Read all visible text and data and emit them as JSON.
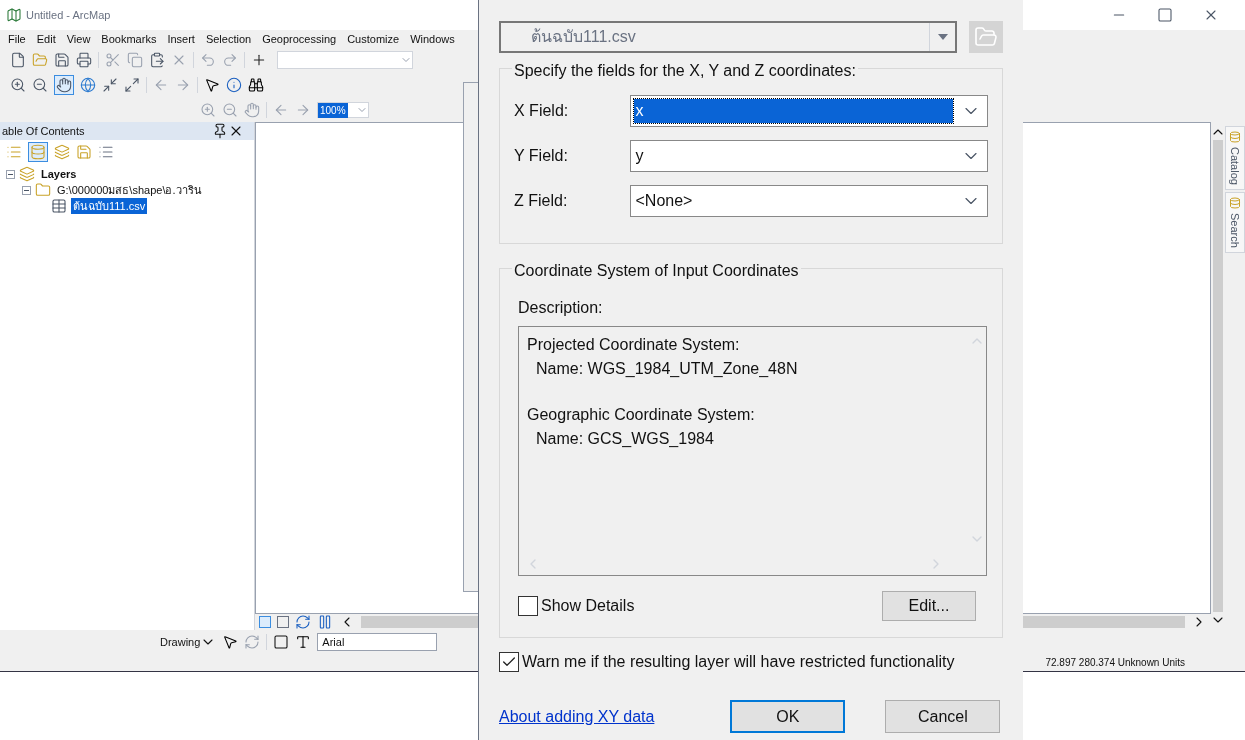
{
  "window": {
    "title": "Untitled - ArcMap"
  },
  "menu": [
    "File",
    "Edit",
    "View",
    "Bookmarks",
    "Insert",
    "Selection",
    "Geoprocessing",
    "Customize",
    "Windows"
  ],
  "zoom_field": {
    "value": "100%"
  },
  "toc": {
    "title": "able Of Contents",
    "tree": [
      {
        "label": "Layers",
        "kind": "group",
        "expanded": true,
        "children": [
          {
            "label": "G:\\000000มสธ\\shape\\อ.วาริน",
            "kind": "folder",
            "expanded": true,
            "children": [
              {
                "label": "ต้นฉบับ111.csv",
                "kind": "table",
                "selected": true
              }
            ]
          }
        ]
      }
    ]
  },
  "side_tabs": [
    "Catalog",
    "Search"
  ],
  "drawing_toolbar": {
    "label": "Drawing",
    "font": "Arial"
  },
  "status_bar": {
    "coordinates": "72.897  280.374 Unknown Units"
  },
  "dialog": {
    "table": "ต้นฉบับ111.csv",
    "fields_group": "Specify the fields for the X, Y and Z coordinates:",
    "fields": [
      {
        "label": "X Field:",
        "value": "x",
        "selected": true
      },
      {
        "label": "Y Field:",
        "value": "y",
        "selected": false
      },
      {
        "label": "Z Field:",
        "value": "<None>",
        "selected": false
      }
    ],
    "coord_group": "Coordinate System of Input Coordinates",
    "description_label": "Description:",
    "description": [
      {
        "kind": "heading",
        "text": "Projected Coordinate System:"
      },
      {
        "kind": "detail",
        "text": "Name: WGS_1984_UTM_Zone_48N"
      },
      {
        "kind": "heading",
        "text": "Geographic Coordinate System:"
      },
      {
        "kind": "detail",
        "text": "Name: GCS_WGS_1984"
      }
    ],
    "show_details": {
      "label": "Show Details",
      "checked": false
    },
    "edit_button": "Edit...",
    "warn": {
      "label": "Warn me if the resulting layer will have restricted functionality",
      "checked": true
    },
    "help_link": "About adding XY data",
    "ok": "OK",
    "cancel": "Cancel"
  }
}
